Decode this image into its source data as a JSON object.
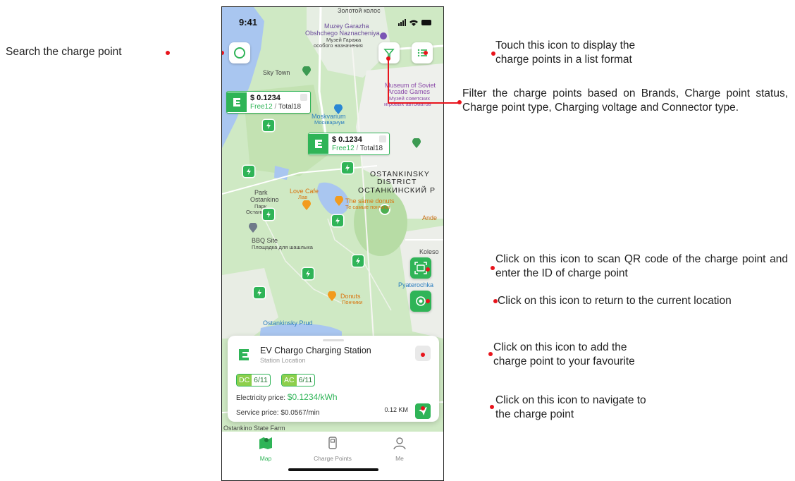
{
  "annotations": {
    "search": "Search the charge point",
    "list": [
      "Touch this icon to display the",
      "charge points in a list format"
    ],
    "filter": "Filter the charge points based on Brands, Charge point status, Charge point type, Charging voltage and Connector type.",
    "scan": "Click on this icon to scan QR code of the charge point and enter the ID of charge point",
    "location": "Click on this icon to return to the current location",
    "favourite": [
      "Click on this icon to add the",
      "charge point to your favourite"
    ],
    "navigate": [
      "Click on this icon to navigate to",
      "the charge point"
    ]
  },
  "status_bar": {
    "time": "9:41"
  },
  "map_labels": {
    "golden": "Золотой колос",
    "muzey": [
      "Muzey Garazha",
      "Obshchego Naznacheniya"
    ],
    "muzey_ru": [
      "Музей Гаража",
      "особого назначения"
    ],
    "skytown": "Sky Town",
    "museum_soviet": [
      "Museum of Soviet",
      "Arcade Games"
    ],
    "museum_soviet_ru": [
      "Музей советских",
      "игровых автоматов"
    ],
    "moskvarium": "Moskvarium",
    "moskvarium_ru": "Москвариум",
    "district_en": [
      "OSTANKINSKY",
      "DISTRICT"
    ],
    "district_ru": "ОСТАНКИНСКИЙ Р",
    "love_cafe": "Love Cafe",
    "love_cafe_ru": "Лав",
    "same_donuts": "The same donuts",
    "same_donuts_ru": "Те самые пончики",
    "park": [
      "Park",
      "Ostankino"
    ],
    "park_ru": [
      "Парк",
      "Останкино"
    ],
    "bbq": "BBQ Site",
    "bbq_ru": "Площадка для шашлыка",
    "koleso": "Koleso",
    "pyaterochka": "Pyaterochka",
    "donuts": "Donuts",
    "donuts_ru": "Пончики",
    "ostankino_pond": "Ostankinsky Prud",
    "state_farm": "Ostankino State Farm",
    "ande": "Ande"
  },
  "price_cards": [
    {
      "price": "$ 0.1234",
      "free": "Free12",
      "sep": "/",
      "total": "Total18"
    },
    {
      "price": "$ 0.1234",
      "free": "Free12",
      "sep": "/",
      "total": "Total18"
    }
  ],
  "station": {
    "name": "EV Chargo Charging Station",
    "location": "Station Location",
    "dc_label": "DC",
    "dc_value": "6/11",
    "ac_label": "AC",
    "ac_value": "6/11",
    "electricity_label": "Electricity price:",
    "electricity_value": "$0.1234/kWh",
    "service_price": "Service price: $0.0567/min",
    "distance": "0.12 KM"
  },
  "tabs": [
    {
      "label": "Map",
      "icon": "map-icon",
      "active": true
    },
    {
      "label": "Charge Points",
      "icon": "charger-icon",
      "active": false
    },
    {
      "label": "Me",
      "icon": "user-icon",
      "active": false
    }
  ],
  "colors": {
    "accent": "#2fb457",
    "annotation_marker": "#e8141c",
    "map_green": "#cfe9c4",
    "water": "#a9c6f0"
  }
}
